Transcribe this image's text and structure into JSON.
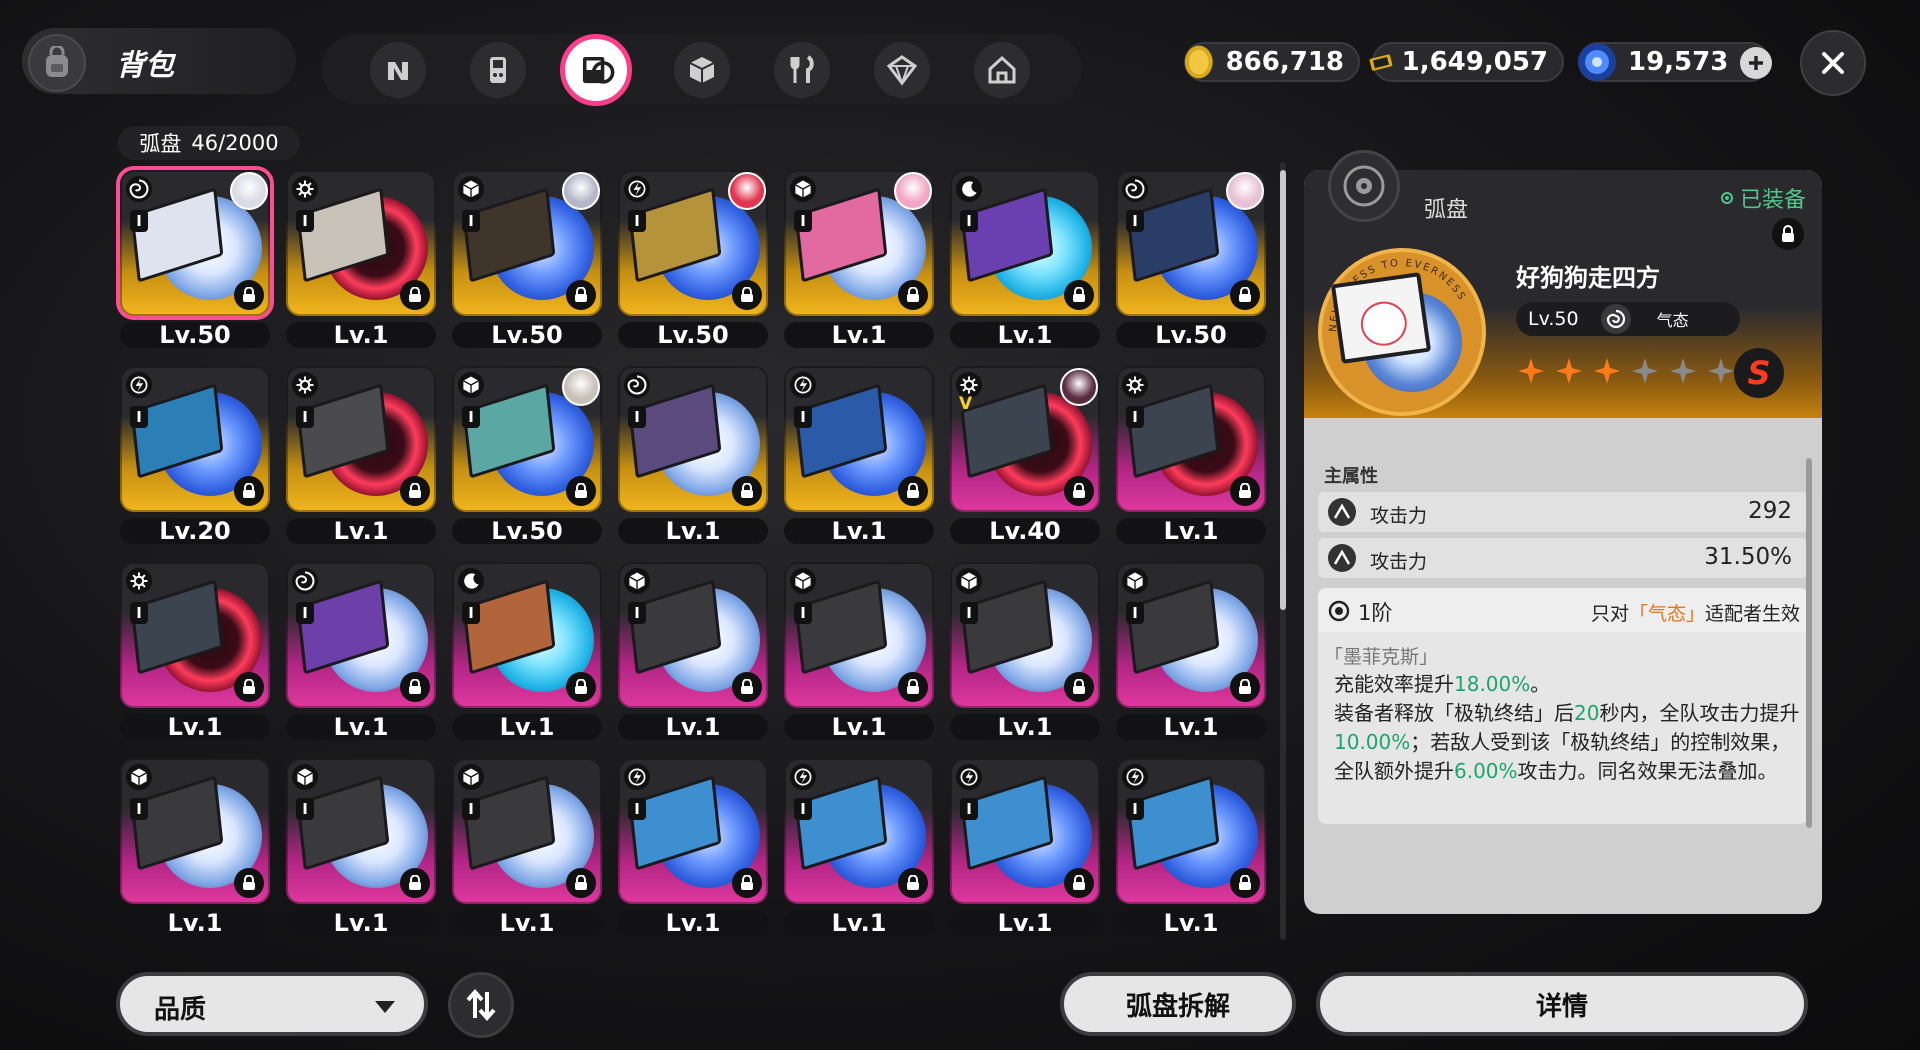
{
  "header": {
    "title": "背包",
    "tabs": [
      {
        "icon": "n-logo-icon"
      },
      {
        "icon": "handheld-console-icon"
      },
      {
        "icon": "arc-disc-icon",
        "active": true
      },
      {
        "icon": "cube-icon"
      },
      {
        "icon": "fork-knife-icon"
      },
      {
        "icon": "gem-box-icon"
      },
      {
        "icon": "house-icon"
      }
    ],
    "currencies": [
      {
        "icon": "gold-coin-icon",
        "value": "866,718"
      },
      {
        "icon": "gold-ticket-icon",
        "value": "1,649,057"
      },
      {
        "icon": "blue-crystal-icon",
        "value": "19,573"
      }
    ]
  },
  "inventory": {
    "label": "弧盘",
    "count": "46/2000",
    "items": [
      {
        "level": "Lv.50",
        "rarity": "gold",
        "element": "swirl",
        "rank": "I",
        "avatar": "#d9dbe6",
        "disc": "white",
        "sleeve": "#dfe3ef",
        "selected": true
      },
      {
        "level": "Lv.1",
        "rarity": "gold",
        "element": "gear",
        "rank": "I",
        "disc": "red",
        "sleeve": "#c9c2b8"
      },
      {
        "level": "Lv.50",
        "rarity": "gold",
        "element": "cube",
        "rank": "I",
        "avatar": "#b5b7c9",
        "disc": "blue",
        "sleeve": "#40352a"
      },
      {
        "level": "Lv.50",
        "rarity": "gold",
        "element": "bolt",
        "rank": "I",
        "avatar": "#e0364f",
        "disc": "blue",
        "sleeve": "#b5933a"
      },
      {
        "level": "Lv.1",
        "rarity": "gold",
        "element": "cube",
        "rank": "I",
        "avatar": "#f2a6c3",
        "disc": "white",
        "sleeve": "#e26aa0"
      },
      {
        "level": "Lv.1",
        "rarity": "gold",
        "element": "moon",
        "rank": "I",
        "disc": "cyan",
        "sleeve": "#6a3fb0"
      },
      {
        "level": "Lv.50",
        "rarity": "gold",
        "element": "swirl",
        "rank": "I",
        "avatar": "#e7c1d4",
        "disc": "blue",
        "sleeve": "#2a3d66"
      },
      {
        "level": "Lv.20",
        "rarity": "gold",
        "element": "bolt",
        "rank": "I",
        "disc": "blue",
        "sleeve": "#2b7fb6"
      },
      {
        "level": "Lv.1",
        "rarity": "gold",
        "element": "gear",
        "rank": "I",
        "disc": "red",
        "sleeve": "#4b4b4f"
      },
      {
        "level": "Lv.50",
        "rarity": "gold",
        "element": "cube",
        "rank": "I",
        "avatar": "#c9c0b8",
        "disc": "blue",
        "sleeve": "#5aa7a3"
      },
      {
        "level": "Lv.1",
        "rarity": "gold",
        "element": "swirl",
        "rank": "I",
        "disc": "white",
        "sleeve": "#5a4a7e"
      },
      {
        "level": "Lv.1",
        "rarity": "gold",
        "element": "bolt",
        "rank": "I",
        "disc": "blue",
        "sleeve": "#2a5aa8"
      },
      {
        "level": "Lv.40",
        "rarity": "pink",
        "element": "gear",
        "rank": "V",
        "avatar": "#5a2c3f",
        "disc": "red",
        "sleeve": "#3c4450"
      },
      {
        "level": "Lv.1",
        "rarity": "pink",
        "element": "gear",
        "rank": "I",
        "disc": "red",
        "sleeve": "#3c4450"
      },
      {
        "level": "Lv.1",
        "rarity": "pink",
        "element": "gear",
        "rank": "I",
        "disc": "red",
        "sleeve": "#3c4450"
      },
      {
        "level": "Lv.1",
        "rarity": "pink",
        "element": "swirl",
        "rank": "I",
        "disc": "white",
        "sleeve": "#6d3fa8"
      },
      {
        "level": "Lv.1",
        "rarity": "pink",
        "element": "moon",
        "rank": "I",
        "disc": "cyan",
        "sleeve": "#b2653a"
      },
      {
        "level": "Lv.1",
        "rarity": "pink",
        "element": "cube",
        "rank": "I",
        "disc": "white",
        "sleeve": "#3a3a3d"
      },
      {
        "level": "Lv.1",
        "rarity": "pink",
        "element": "cube",
        "rank": "I",
        "disc": "white",
        "sleeve": "#3a3a3d"
      },
      {
        "level": "Lv.1",
        "rarity": "pink",
        "element": "cube",
        "rank": "I",
        "disc": "white",
        "sleeve": "#3a3a3d"
      },
      {
        "level": "Lv.1",
        "rarity": "pink",
        "element": "cube",
        "rank": "I",
        "disc": "white",
        "sleeve": "#3a3a3d"
      },
      {
        "level": "Lv.1",
        "rarity": "pink",
        "element": "cube",
        "rank": "I",
        "disc": "white",
        "sleeve": "#3a3a3d"
      },
      {
        "level": "Lv.1",
        "rarity": "pink",
        "element": "cube",
        "rank": "I",
        "disc": "white",
        "sleeve": "#3a3a3d"
      },
      {
        "level": "Lv.1",
        "rarity": "pink",
        "element": "cube",
        "rank": "I",
        "disc": "white",
        "sleeve": "#3a3a3d"
      },
      {
        "level": "Lv.1",
        "rarity": "pink",
        "element": "bolt",
        "rank": "I",
        "disc": "blue",
        "sleeve": "#3d8fcf"
      },
      {
        "level": "Lv.1",
        "rarity": "pink",
        "element": "bolt",
        "rank": "I",
        "disc": "blue",
        "sleeve": "#3d8fcf"
      },
      {
        "level": "Lv.1",
        "rarity": "pink",
        "element": "bolt",
        "rank": "I",
        "disc": "blue",
        "sleeve": "#3d8fcf"
      },
      {
        "level": "Lv.1",
        "rarity": "pink",
        "element": "bolt",
        "rank": "I",
        "disc": "blue",
        "sleeve": "#3d8fcf"
      }
    ]
  },
  "footer": {
    "quality_label": "品质",
    "dismantle_label": "弧盘拆解",
    "details_label": "详情"
  },
  "detail": {
    "category": "弧盘",
    "equipped_label": "已装备",
    "name": "好狗狗走四方",
    "level": "Lv.50",
    "element_name": "气态",
    "stars_filled": 3,
    "stars_total": 6,
    "ring_text": "NEVERNESS TO EVERNESS",
    "rarity_badge": "S",
    "main_attr_title": "主属性",
    "stats": [
      {
        "name": "攻击力",
        "value": "292"
      },
      {
        "name": "攻击力",
        "value": "31.50%"
      }
    ],
    "tier": "1阶",
    "tier_note_pre": "只对",
    "tier_note_highlight": "「气态」",
    "tier_note_post": "适配者生效",
    "effect_name": "「墨菲克斯」",
    "effect_line1_pre": "充能效率提升",
    "effect_line1_val": "18.00%",
    "effect_line1_post": "。",
    "effect_p2_a": "装备者释放「极轨终结」后",
    "effect_p2_b": "20",
    "effect_p2_c": "秒内，全队攻击力提升",
    "effect_p2_d": "10.00%",
    "effect_p2_e": "；若敌人受到该「极轨终结」的控制效果，全队额外提升",
    "effect_p2_f": "6.00%",
    "effect_p2_g": "攻击力。同名效果无法叠加。"
  },
  "colors": {
    "accent_pink": "#ff3d8b",
    "gold_rarity": "#f2b61e",
    "pink_rarity": "#e0389f",
    "highlight_green": "#1fa372",
    "highlight_orange": "#e0781c",
    "equipped_green": "#4fc68a"
  }
}
